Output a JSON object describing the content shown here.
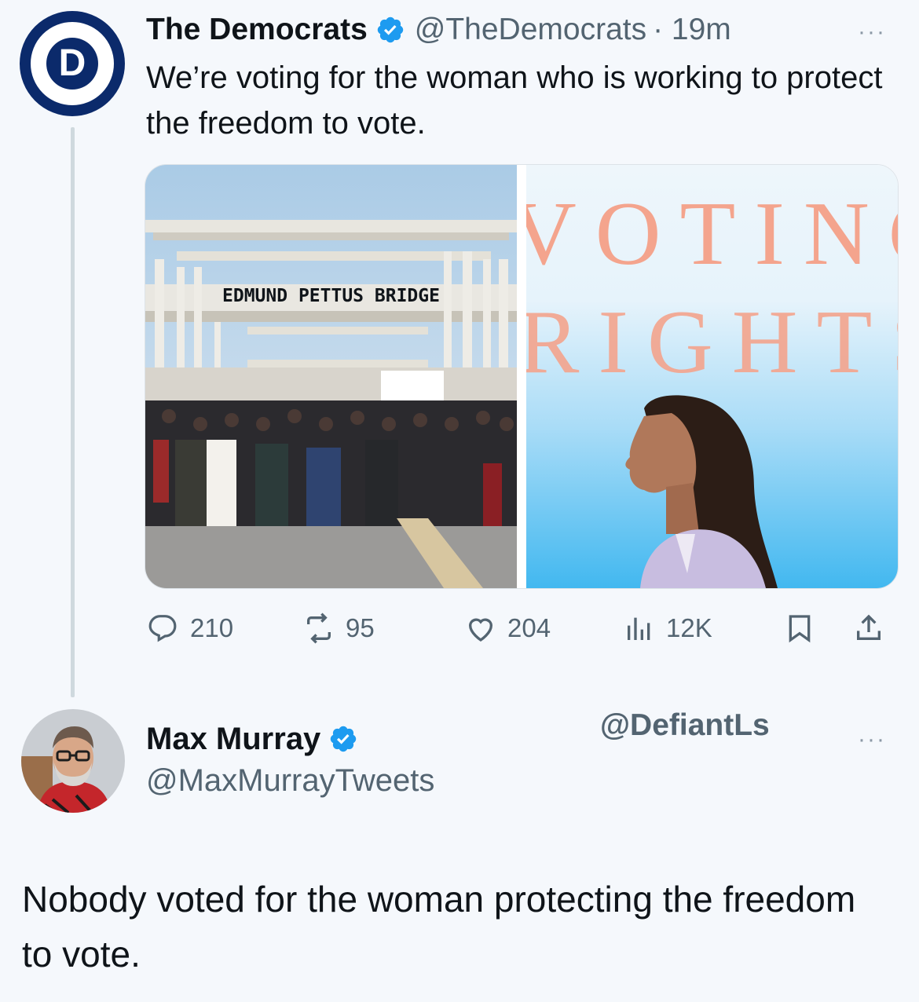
{
  "parent_tweet": {
    "display_name": "The Democrats",
    "handle": "@TheDemocrats",
    "time": "· 19m",
    "avatar_letter": "D",
    "text": "We’re voting for the woman who is working to protect the freedom to vote.",
    "images": {
      "left_sign": "EDMUND PETTUS BRIDGE",
      "right_word_1": "VOTING",
      "right_word_2": "RIGHTS"
    },
    "metrics": {
      "replies": "210",
      "reposts": "95",
      "likes": "204",
      "views": "12K"
    }
  },
  "reply_tweet": {
    "display_name": "Max Murray",
    "handle": "@MaxMurrayTweets",
    "text": "Nobody voted for the woman protecting the freedom to vote."
  },
  "watermark": "@DefiantLs",
  "more_label": "···",
  "colors": {
    "verified": "#1d9bf0",
    "dem_blue": "#0b2a6b",
    "secondary_text": "#536471",
    "background": "#f5f8fc"
  },
  "icons": [
    "reply-icon",
    "repost-icon",
    "like-icon",
    "views-icon",
    "bookmark-icon",
    "share-icon",
    "verified-badge-icon",
    "more-icon"
  ]
}
